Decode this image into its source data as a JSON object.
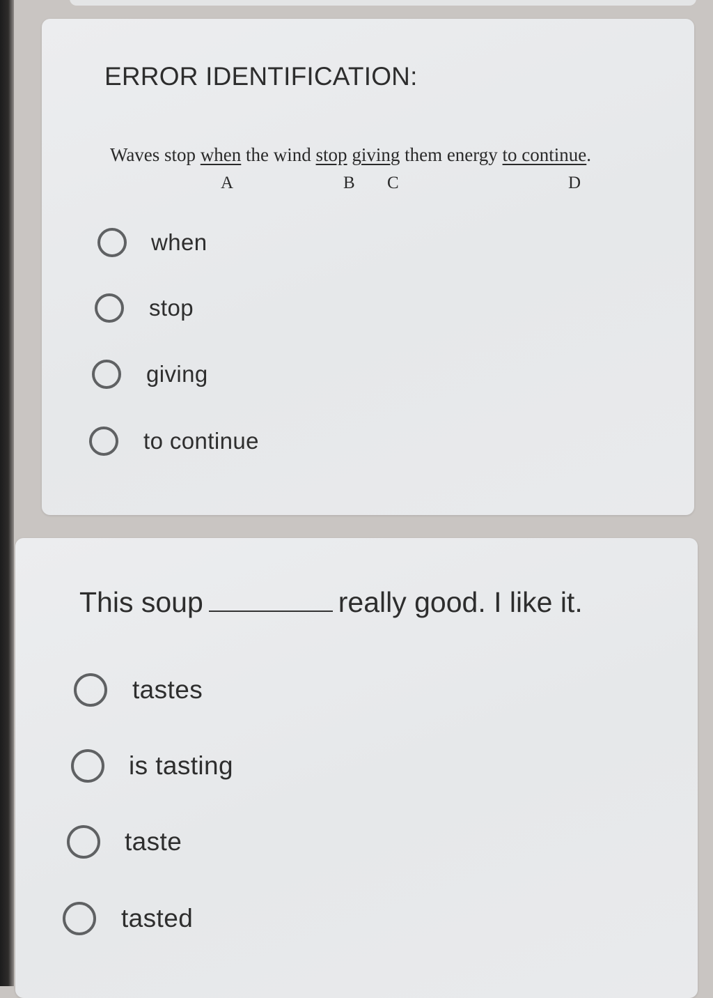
{
  "card1": {
    "heading": "ERROR IDENTIFICATION:",
    "sentence": {
      "w1": "Waves stop ",
      "when": "when",
      "w2": " the wind ",
      "stop": "stop",
      "giving": "giving",
      "w3": " them energy ",
      "to_continue": "to continue",
      "w4": "."
    },
    "letters": {
      "a": "A",
      "b": "B",
      "c": "C",
      "d": "D"
    },
    "options": [
      "when",
      "stop",
      "giving",
      "to continue"
    ]
  },
  "card2": {
    "question_start": "This soup",
    "question_end": "really good. I like it.",
    "options": [
      "tastes",
      "is tasting",
      "taste",
      "tasted"
    ]
  }
}
